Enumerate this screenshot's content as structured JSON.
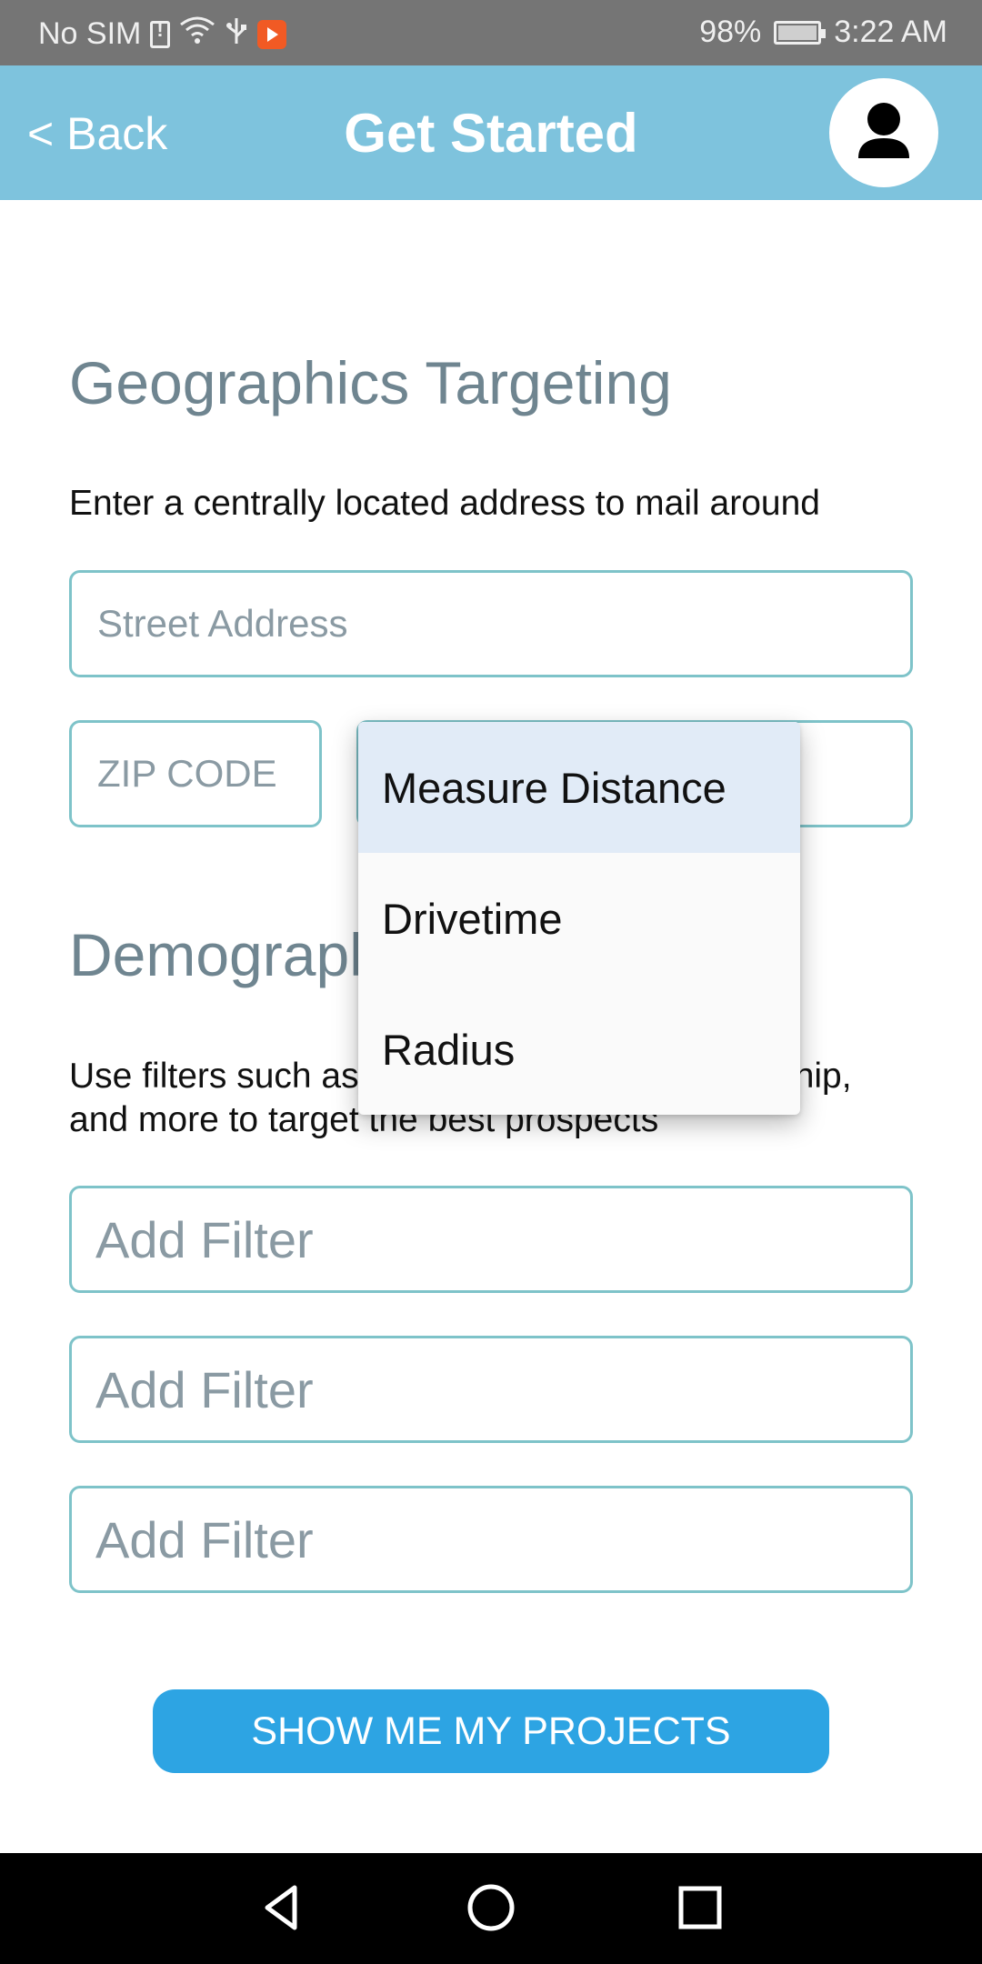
{
  "status_bar": {
    "carrier": "No SIM",
    "battery": "98%",
    "time": "3:22 AM",
    "icons": [
      "sim-alert-icon",
      "wifi-icon",
      "usb-icon",
      "notification-app-icon",
      "battery-charging-icon"
    ]
  },
  "header": {
    "back_label": "< Back",
    "title": "Get Started",
    "avatar_icon": "user-icon",
    "color": "#7ec3dd"
  },
  "geo": {
    "title": "Geographics Targeting",
    "description": "Enter a centrally located address to mail around",
    "street_placeholder": "Street Address",
    "zip_placeholder": "ZIP CODE"
  },
  "dropdown": {
    "options": [
      "Measure Distance",
      "Drivetime",
      "Radius"
    ],
    "selected": "Measure Distance"
  },
  "demo": {
    "title": "Demographics Targeting",
    "description_line1": "Use filters such as age, income, home ownership,",
    "description_line2": "and more to target the best prospects",
    "filter_placeholder": "Add Filter"
  },
  "cta": {
    "label": "SHOW ME MY PROJECTS",
    "color": "#2da4e3"
  },
  "nav": {
    "icons": [
      "back-triangle-icon",
      "home-circle-icon",
      "recents-square-icon"
    ]
  }
}
